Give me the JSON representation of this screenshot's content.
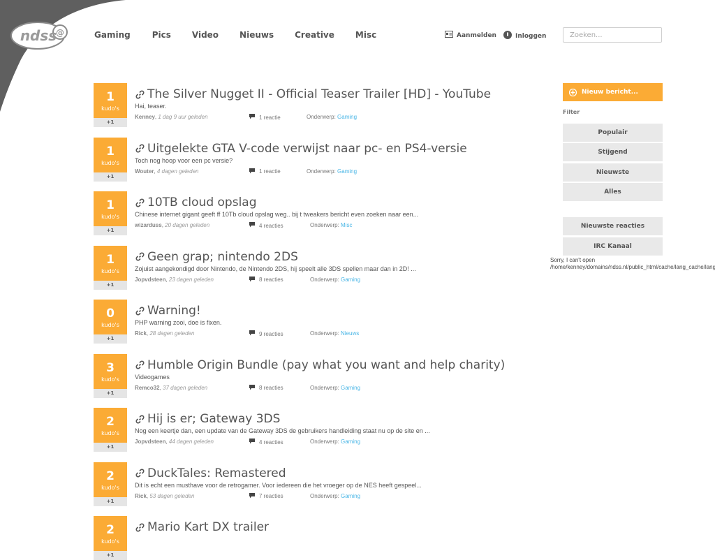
{
  "header": {
    "logo_text": "ndss",
    "nav": [
      "Gaming",
      "Pics",
      "Video",
      "Nieuws",
      "Creative",
      "Misc"
    ],
    "register_label": "Aanmelden",
    "login_label": "Inloggen",
    "search_placeholder": "Zoeken..."
  },
  "kudos_label": "kudo's",
  "plus_label": "+1",
  "topic_label": "Onderwerp:",
  "posts": [
    {
      "kudos": "1",
      "title": "The Silver Nugget II - Official Teaser Trailer [HD] - YouTube",
      "desc": "Hai, teaser.",
      "author": "Kenney",
      "ago": "1 dag 9 uur geleden",
      "reactions": "1 reactie",
      "category": "Gaming"
    },
    {
      "kudos": "1",
      "title": "Uitgelekte GTA V-code verwijst naar pc- en PS4-versie",
      "desc": "Toch nog hoop voor een pc versie?",
      "author": "Wouter",
      "ago": "4 dagen geleden",
      "reactions": "1 reactie",
      "category": "Gaming"
    },
    {
      "kudos": "1",
      "title": "10TB cloud opslag",
      "desc": "Chinese internet gigant geeft ff 10Tb cloud opslag weg.. bij t tweakers bericht even zoeken naar een...",
      "author": "wizarduss",
      "ago": "20 dagen geleden",
      "reactions": "4 reacties",
      "category": "Misc"
    },
    {
      "kudos": "1",
      "title": "Geen grap; nintendo 2DS",
      "desc": "Zojuist aangekondigd door Nintendo, de Nintendo 2DS, hij speelt alle 3DS spellen maar dan in 2D! ...",
      "author": "Jopvdsteen",
      "ago": "23 dagen geleden",
      "reactions": "8 reacties",
      "category": "Gaming"
    },
    {
      "kudos": "0",
      "title": "Warning!",
      "desc": "PHP warning zooi, doe is fixen.",
      "author": "Rick",
      "ago": "28 dagen geleden",
      "reactions": "9 reacties",
      "category": "Nieuws"
    },
    {
      "kudos": "3",
      "title": "Humble Origin Bundle (pay what you want and help charity)",
      "desc": "Videogames",
      "author": "Remco32",
      "ago": "37 dagen geleden",
      "reactions": "8 reacties",
      "category": "Gaming"
    },
    {
      "kudos": "2",
      "title": "Hij is er; Gateway 3DS",
      "desc": "Nog een keertje dan, een update van de Gateway 3DS de gebruikers handleiding staat nu op de site en ...",
      "author": "Jopvdsteen",
      "ago": "44 dagen geleden",
      "reactions": "4 reacties",
      "category": "Gaming"
    },
    {
      "kudos": "2",
      "title": "DuckTales: Remastered",
      "desc": "Dit is echt een musthave voor de retrogamer. Voor iedereen die het vroeger op de NES heeft gespeel...",
      "author": "Rick",
      "ago": "53 dagen geleden",
      "reactions": "7 reacties",
      "category": "Gaming"
    },
    {
      "kudos": "2",
      "title": "Mario Kart DX trailer",
      "desc": "",
      "author": "",
      "ago": "",
      "reactions": "",
      "category": ""
    }
  ],
  "sidebar": {
    "new_post_label": "Nieuw bericht...",
    "filter_label": "Filter",
    "filters": [
      "Populair",
      "Stijgend",
      "Nieuwste",
      "Alles"
    ],
    "latest_reactions_label": "Nieuwste reacties",
    "irc_label": "IRC Kanaal",
    "error_message": "Sorry, I can't open /home/kenney/domains/ndss.nl/public_html/cache/lang_cache/language.php"
  },
  "colors": {
    "accent": "#fbab35",
    "link": "#4ab6e6",
    "corner": "#5f5f5f"
  }
}
